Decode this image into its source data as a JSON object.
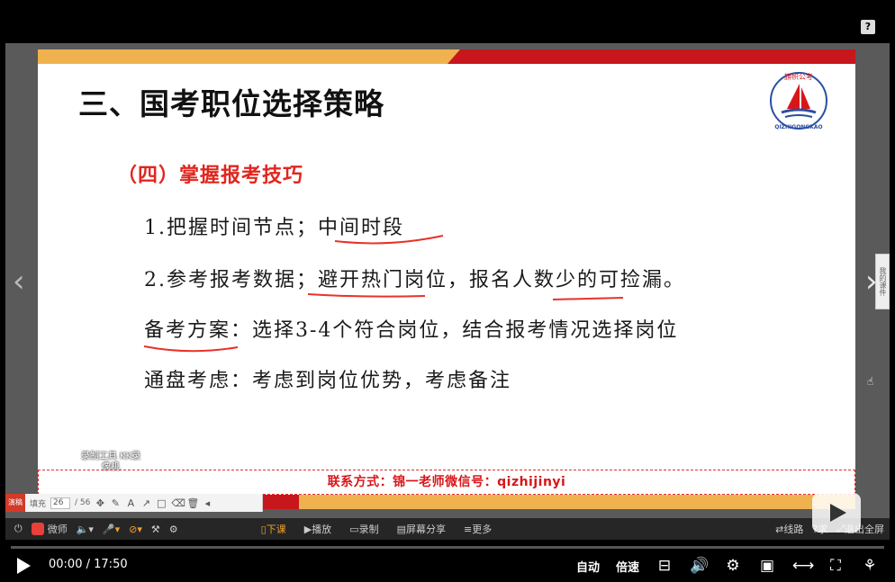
{
  "help_icon": "?",
  "slide": {
    "title": "三、国考职位选择策略",
    "logo_text": "QIZHIGONGKAO",
    "logo_top_text": "旗帜公考",
    "subtitle": "（四）掌握报考技巧",
    "lines": [
      "1.把握时间节点；中间时段",
      "2.参考报考数据；避开热门岗位，报名人数少的可捡漏。",
      "备考方案：选择3-4个符合岗位，结合报考情况选择岗位",
      "通盘考虑：考虑到岗位优势，考虑备注"
    ],
    "contact": "联系方式：锦一老师微信号：qizhijinyi",
    "watermark": "录制工具 KK录像机"
  },
  "annotation_bar": {
    "tag": "演稿",
    "label": "填充",
    "page_current": "26",
    "page_total": "/ 56"
  },
  "side_tab": "我的课件",
  "host_toolbar": {
    "app_name": "微师",
    "items": [
      "下课",
      "播放",
      "录制",
      "屏幕分享",
      "更多"
    ],
    "right_items": [
      "线路",
      "求",
      "退出全屏"
    ]
  },
  "player": {
    "time_current": "00:00",
    "time_sep": "/",
    "time_total": "17:50",
    "auto_label": "自动",
    "speed_label": "倍速",
    "progress": 0
  },
  "colors": {
    "accent_red": "#c8161d",
    "accent_gold": "#f0b24e",
    "subtitle_red": "#e0261f"
  }
}
